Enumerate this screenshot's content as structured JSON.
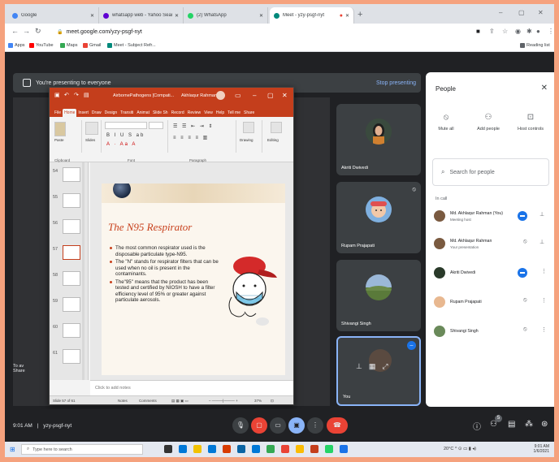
{
  "browser": {
    "tabs": [
      {
        "title": "Google",
        "color": "#4285f4"
      },
      {
        "title": "whatsapp web - Yahoo Search R",
        "color": "#6001d2"
      },
      {
        "title": "(2) WhatsApp",
        "color": "#25d366"
      },
      {
        "title": "Meet - yzy-psgf-nyt",
        "color": "#00897b"
      }
    ],
    "url": "meet.google.com/yzy-psgf-nyt",
    "bookmarks": [
      "Apps",
      "YouTube",
      "Maps",
      "Gmail",
      "Meet - Subject Refr..."
    ],
    "reading_list": "Reading list"
  },
  "meet": {
    "presenting_text": "You're presenting to everyone",
    "stop_presenting": "Stop presenting",
    "participants": [
      {
        "name": "Akriti Dwivedi"
      },
      {
        "name": "Rupam Prajapati"
      },
      {
        "name": "Shivangi Singh"
      },
      {
        "name": "You"
      }
    ],
    "time": "9:01 AM",
    "meeting_code": "yzy-psgf-nyt",
    "participant_count": "5",
    "shared_hint_1": "To av",
    "shared_hint_2": "Share"
  },
  "ppt": {
    "file_title": "AirbornePathogens [Compati...",
    "user": "Akhlaqur Rahman",
    "menu": [
      "File",
      "Home",
      "Insert",
      "Draw",
      "Design",
      "Transiti",
      "Animat",
      "Slide Sh",
      "Record",
      "Review",
      "View",
      "Help",
      "Tell me",
      "Share"
    ],
    "ribbon": {
      "clipboard": "Clipboard",
      "paste": "Paste",
      "slides": "Slides",
      "font": "Font",
      "paragraph": "Paragraph",
      "drawing": "Drawing",
      "editing": "Editing"
    },
    "thumbs": [
      "54",
      "55",
      "56",
      "57",
      "58",
      "59",
      "60",
      "61"
    ],
    "slide": {
      "title": "The N95 Respirator",
      "bullets": [
        "The most common respirator used is the disposable particulate type-N95.",
        "The \"N\" stands for respirator filters that can be used when no oil is present in the contaminants.",
        "The\"95\" means that the product has been tested and certified by NIOSH to have a filter efficiency level of 95% or greater against particulate aerosols."
      ]
    },
    "notes_placeholder": "Click to add notes",
    "status": {
      "slide": "Slide 57 of 61",
      "notes": "Notes",
      "comments": "Comments",
      "zoom": "37%"
    }
  },
  "people_panel": {
    "title": "People",
    "actions": [
      "Mute all",
      "Add people",
      "Host controls"
    ],
    "search_placeholder": "Search for people",
    "in_call": "In call",
    "list": [
      {
        "name": "Md. Akhlaqur Rahman (You)",
        "sub": "Meeting host"
      },
      {
        "name": "Md. Akhlaqur Rahman",
        "sub": "Your presentation"
      },
      {
        "name": "Akriti Dwivedi",
        "sub": ""
      },
      {
        "name": "Rupam Prajapati",
        "sub": ""
      },
      {
        "name": "Shivangi Singh",
        "sub": ""
      }
    ]
  },
  "taskbar": {
    "search_placeholder": "Type here to search",
    "weather": "20°C",
    "time": "9:01 AM",
    "date": "1/6/2021"
  },
  "colors": {
    "accent": "#1a73e8",
    "ppt": "#c43e1c",
    "end_call": "#ea4335"
  }
}
